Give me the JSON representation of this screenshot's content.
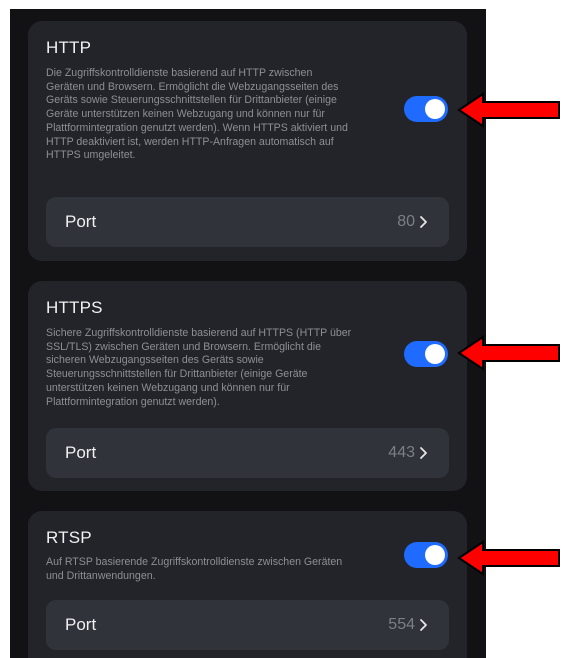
{
  "sections": [
    {
      "title": "HTTP",
      "description": "Die Zugriffskontrolldienste basierend auf HTTP zwischen Geräten und Browsern. Ermöglicht die Webzugangsseiten des Geräts sowie Steuerungsschnittstellen für Drittanbieter (einige Geräte unterstützen keinen Webzugang und können nur für Plattformintegration genutzt werden). Wenn HTTPS aktiviert und HTTP deaktiviert ist, werden HTTP-Anfragen automatisch auf HTTPS umgeleitet.",
      "enabled": true,
      "port_label": "Port",
      "port_value": "80"
    },
    {
      "title": "HTTPS",
      "description": "Sichere Zugriffskontrolldienste basierend auf HTTPS (HTTP über SSL/TLS) zwischen Geräten und Browsern. Ermöglicht die sicheren Webzugangsseiten des Geräts sowie Steuerungsschnittstellen für Drittanbieter (einige Geräte unterstützen keinen Webzugang und können nur für Plattformintegration genutzt werden).",
      "enabled": true,
      "port_label": "Port",
      "port_value": "443"
    },
    {
      "title": "RTSP",
      "description": "Auf RTSP basierende Zugriffskontrolldienste zwischen Geräten und Drittanwendungen.",
      "enabled": true,
      "port_label": "Port",
      "port_value": "554"
    }
  ],
  "colors": {
    "background": "#121214",
    "card": "#222429",
    "row": "#30333a",
    "toggle_on": "#1f6bff",
    "annotation_arrow": "#ff0000"
  },
  "icons": {
    "chevron": "chevron-right-icon",
    "annotation": "red-arrow-icon"
  }
}
